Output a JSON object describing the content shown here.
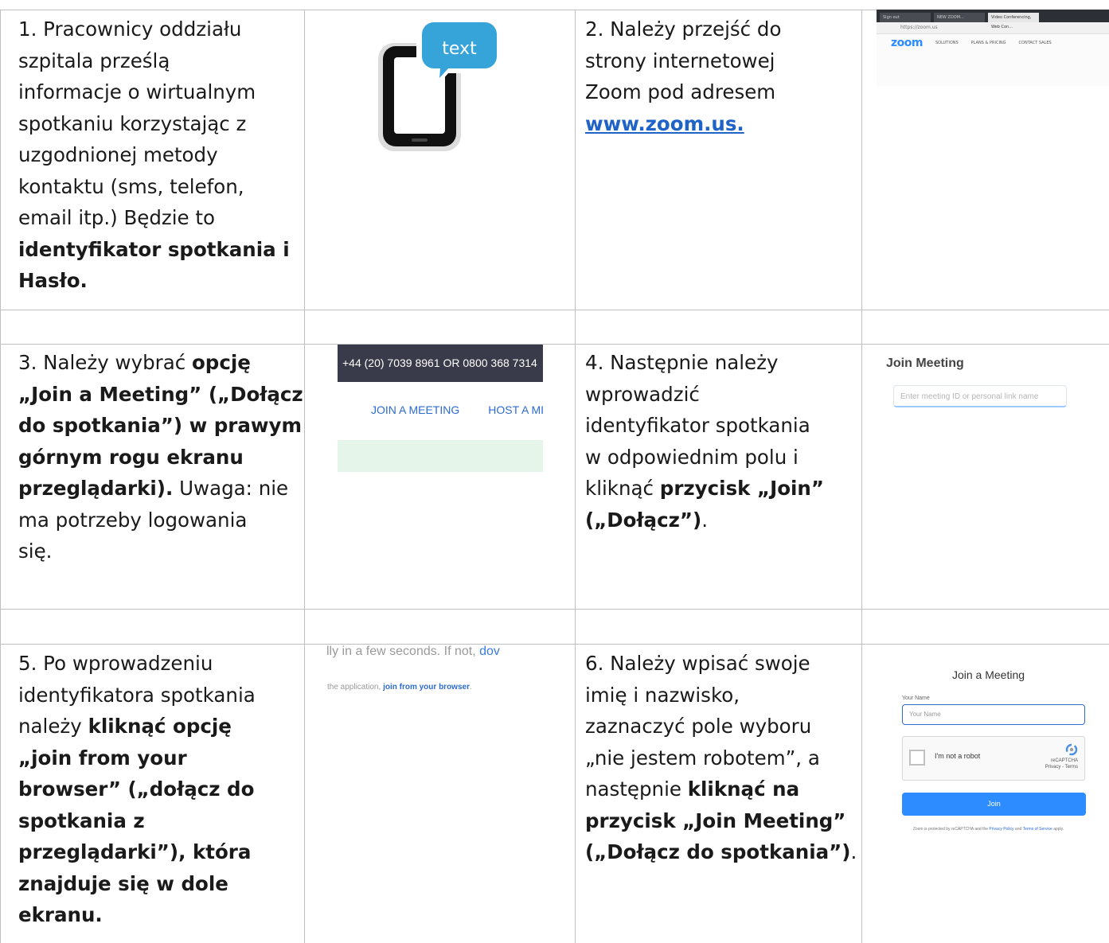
{
  "rows": [
    {
      "left": {
        "segments": [
          {
            "text": "1. Pracownicy oddziału\nszpitala prześlą\ninformacje o wirtualnym\nspotkaniu korzystając z\nuzgodnionej metody\nkontaktu (sms, telefon,\nemail itp.) Będzie to\n",
            "bold": false
          },
          {
            "text": "identyfikator spotkania i\nHasło.",
            "bold": true
          }
        ]
      },
      "right": {
        "segments": [
          {
            "text": "2. Należy przejść do\nstrony internetowej\nZoom pod adresem\n",
            "bold": false
          },
          {
            "text": "www.zoom.us.",
            "bold": true,
            "link": true
          }
        ]
      }
    },
    {
      "left": {
        "segments": [
          {
            "text": "3. Należy wybrać ",
            "bold": false
          },
          {
            "text": "opcję\n„Join a Meeting” („Dołącz\ndo spotkania”) w prawym\ngórnym rogu ekranu\nprzeglądarki).",
            "bold": true
          },
          {
            "text": " Uwaga: nie\nma potrzeby logowania\nsię.",
            "bold": false
          }
        ]
      },
      "right": {
        "segments": [
          {
            "text": "4. Następnie należy\nwprowadzić\nidentyfikator spotkania\nw odpowiednim polu i\nkliknąć ",
            "bold": false
          },
          {
            "text": "przycisk „Join”\n(„Dołącz”)",
            "bold": true
          },
          {
            "text": ".",
            "bold": false
          }
        ]
      }
    },
    {
      "left": {
        "segments": [
          {
            "text": "5. Po wprowadzeniu\nidentyfikatora spotkania\nnależy ",
            "bold": false
          },
          {
            "text": "kliknąć opcję\n„join from your\nbrowser” („dołącz do\nspotkania z\nprzeglądarki”), która\nznajduje się w dole\nekranu.",
            "bold": true
          }
        ]
      },
      "right": {
        "segments": [
          {
            "text": "6. Należy wpisać swoje\nimię i nazwisko,\nzaznaczyć pole wyboru\n„nie jestem robotem”, a\nnastępnie ",
            "bold": false
          },
          {
            "text": "kliknąć na\nprzycisk „Join Meeting”\n(„Dołącz do spotkania”)",
            "bold": true
          },
          {
            "text": ".",
            "bold": false
          }
        ]
      }
    }
  ],
  "phone_icon": {
    "bubble_text": "text"
  },
  "zoom_site": {
    "tabs": [
      "Sign out",
      "NEW ZOOM...",
      "Video Conferencing, Web Con..."
    ],
    "address": "https://zoom.us",
    "logo": "zoom",
    "nav": [
      "SOLUTIONS",
      "PLANS & PRICING",
      "CONTACT SALES"
    ]
  },
  "join_banner": {
    "phone": "+44 (20) 7039 8961 OR 0800 368 7314",
    "join_link": "JOIN A MEETING",
    "host_link": "HOST A MI"
  },
  "join_meeting": {
    "title": "Join Meeting",
    "placeholder": "Enter meeting ID or personal link name"
  },
  "browser_text": {
    "line1_prefix": "lly in a few seconds. If not, ",
    "line1_link": "dov",
    "line2_prefix": "the application, ",
    "line2_link": "join from your browser",
    "line2_suffix": "."
  },
  "join_form": {
    "title": "Join a Meeting",
    "name_label": "Your Name",
    "name_placeholder": "Your Name",
    "robot_label": "I'm not a robot",
    "recaptcha": "reCAPTCHA",
    "recaptcha_links": "Privacy - Terms",
    "join_button": "Join",
    "footer_prefix": "Zoom is protected by reCAPTCHA and the ",
    "footer_privacy": "Privacy Policy",
    "footer_and": " and ",
    "footer_terms": "Terms of Service",
    "footer_suffix": " apply."
  }
}
